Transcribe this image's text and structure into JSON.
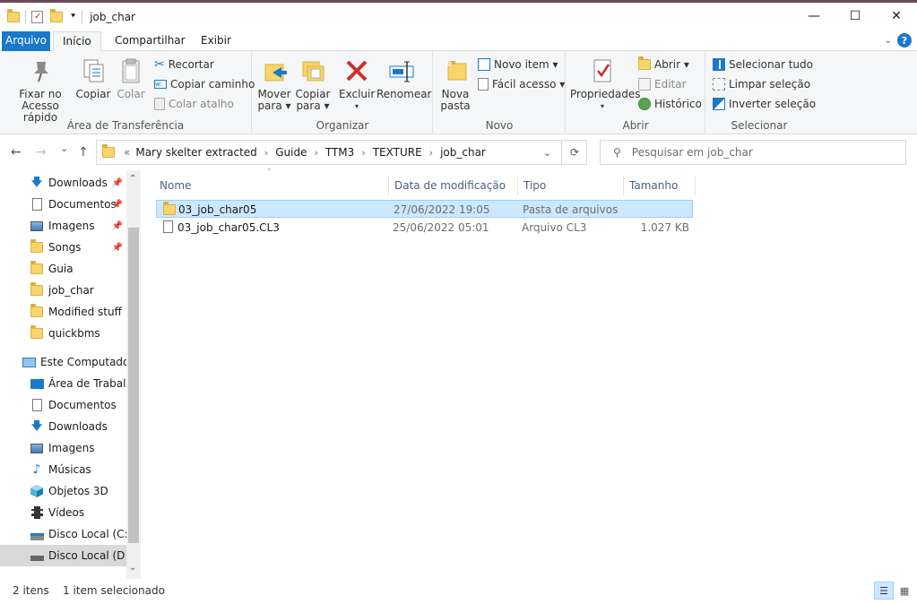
{
  "window": {
    "title": "job_char",
    "minimize": "—",
    "maximize": "☐",
    "close": "✕"
  },
  "tabs": {
    "file": "Arquivo",
    "home": "Início",
    "share": "Compartilhar",
    "view": "Exibir"
  },
  "ribbon": {
    "clipboard": {
      "pin": "Fixar no\nAcesso rápido",
      "copy": "Copiar",
      "paste": "Colar",
      "cut": "Recortar",
      "copy_path": "Copiar caminho",
      "paste_shortcut": "Colar atalho",
      "label": "Área de Transferência"
    },
    "organize": {
      "move": "Mover\npara ▾",
      "copy": "Copiar\npara ▾",
      "delete": "Excluir",
      "rename": "Renomear",
      "label": "Organizar"
    },
    "new": {
      "folder": "Nova\npasta",
      "item": "Novo item ▾",
      "access": "Fácil acesso ▾",
      "label": "Novo"
    },
    "open": {
      "props": "Propriedades",
      "open": "Abrir ▾",
      "edit": "Editar",
      "history": "Histórico",
      "label": "Abrir"
    },
    "select": {
      "all": "Selecionar tudo",
      "none": "Limpar seleção",
      "invert": "Inverter seleção",
      "label": "Selecionar"
    }
  },
  "address": {
    "back": "←",
    "forward": "→",
    "dropdown": "⌄",
    "up": "↑",
    "prefix": "«",
    "crumbs": [
      "Mary skelter extracted",
      "Guide",
      "TTM3",
      "TEXTURE",
      "job_char"
    ],
    "search_placeholder": "Pesquisar em job_char"
  },
  "nav": {
    "quick": [
      "Downloads",
      "Documentos",
      "Imagens",
      "Songs",
      "Guia",
      "job_char",
      "Modified stuff",
      "quickbms"
    ],
    "pc": "Este Computador",
    "pc_items": [
      "Área de Trabalho",
      "Documentos",
      "Downloads",
      "Imagens",
      "Músicas",
      "Objetos 3D",
      "Vídeos",
      "Disco Local (C:)",
      "Disco Local (D:)"
    ]
  },
  "columns": {
    "name": "Nome",
    "date": "Data de modificação",
    "type": "Tipo",
    "size": "Tamanho"
  },
  "files": [
    {
      "name": "03_job_char05",
      "date": "27/06/2022 19:05",
      "type": "Pasta de arquivos",
      "size": ""
    },
    {
      "name": "03_job_char05.CL3",
      "date": "25/06/2022 05:01",
      "type": "Arquivo CL3",
      "size": "1.027 KB"
    }
  ],
  "status": {
    "count": "2 itens",
    "selected": "1 item selecionado"
  }
}
